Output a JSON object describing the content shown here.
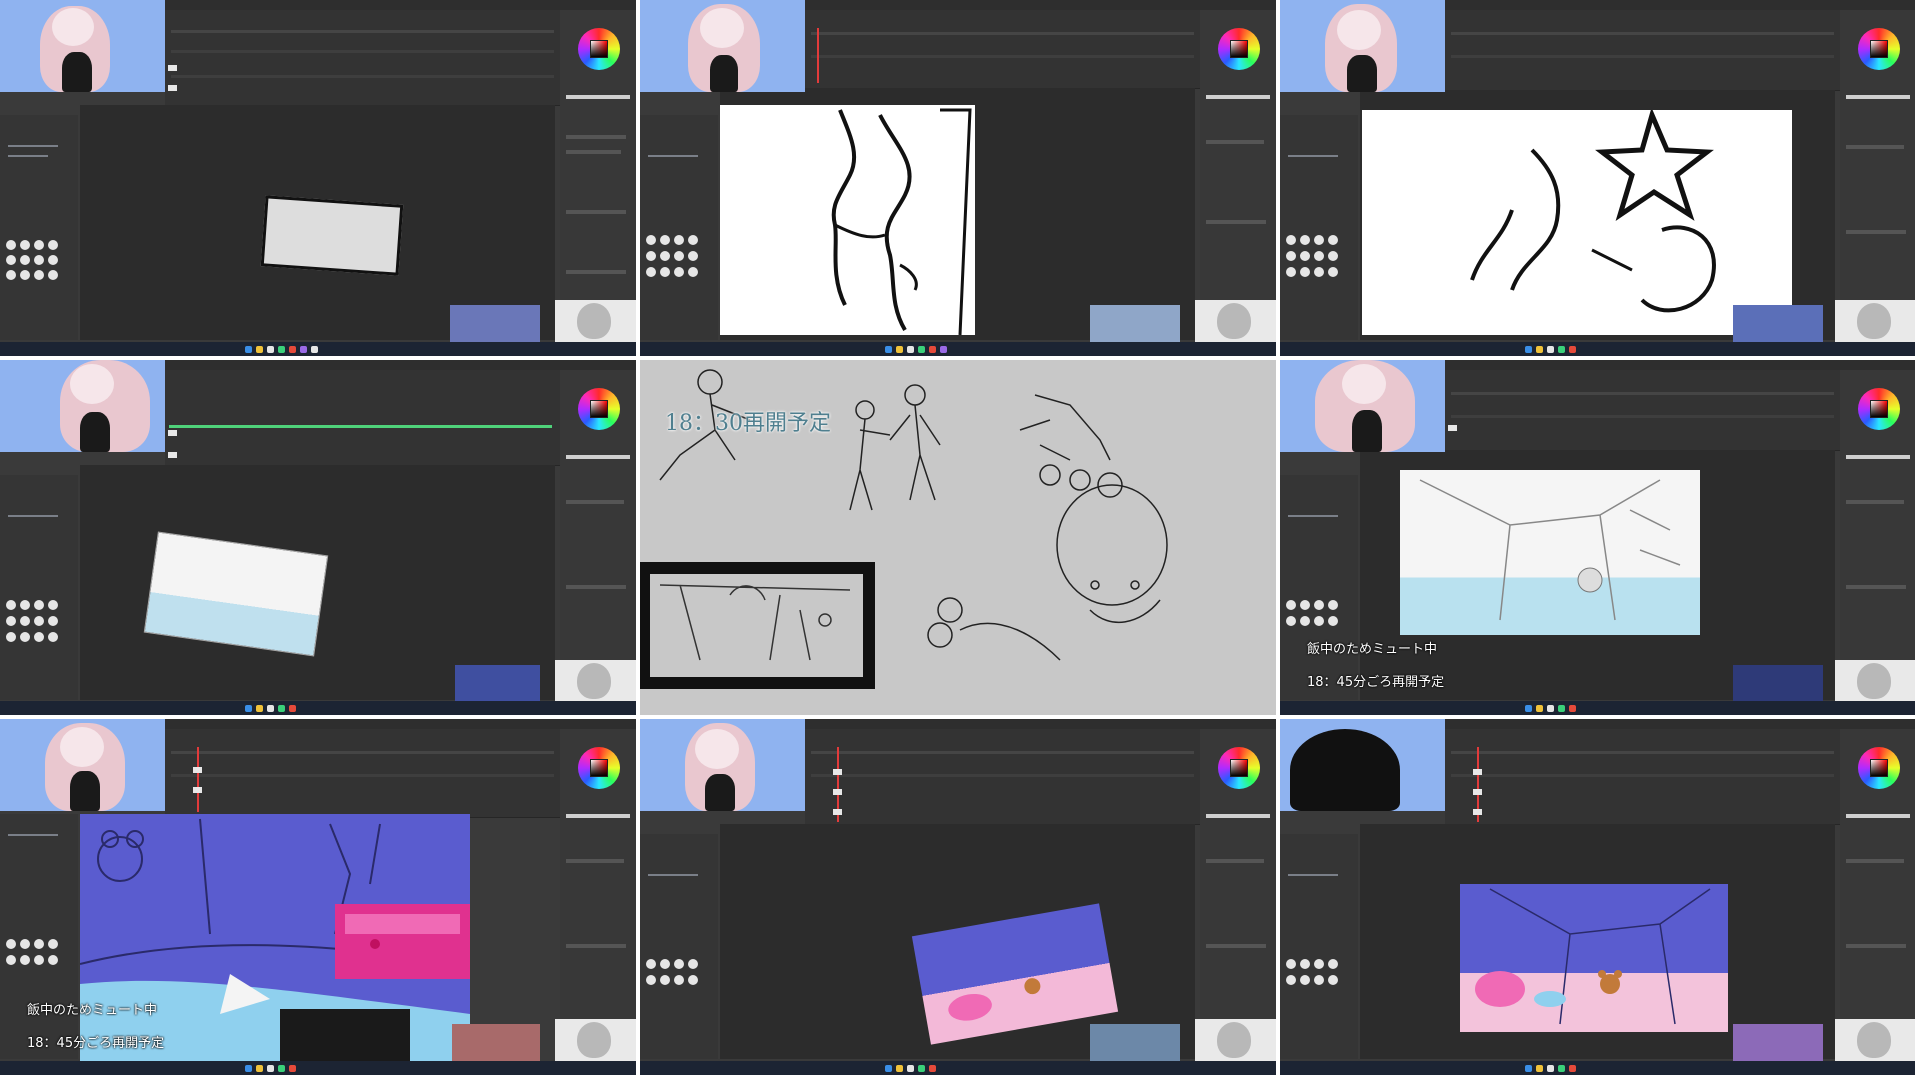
{
  "window": {
    "title": "",
    "layout": "3x3 stream screenshot grid"
  },
  "overlays": {
    "resume_1830": "18：30再開予定",
    "mute_eating": "飯中のためミュート中",
    "resume_1845": "18：45分ごろ再開予定"
  },
  "colors": {
    "accent_blue": "#8fb3f0",
    "timeline_green": "#4fd27a",
    "playhead_red": "#e23b3b",
    "art_purple": "#5a5ccf",
    "art_magenta": "#e0318f"
  }
}
